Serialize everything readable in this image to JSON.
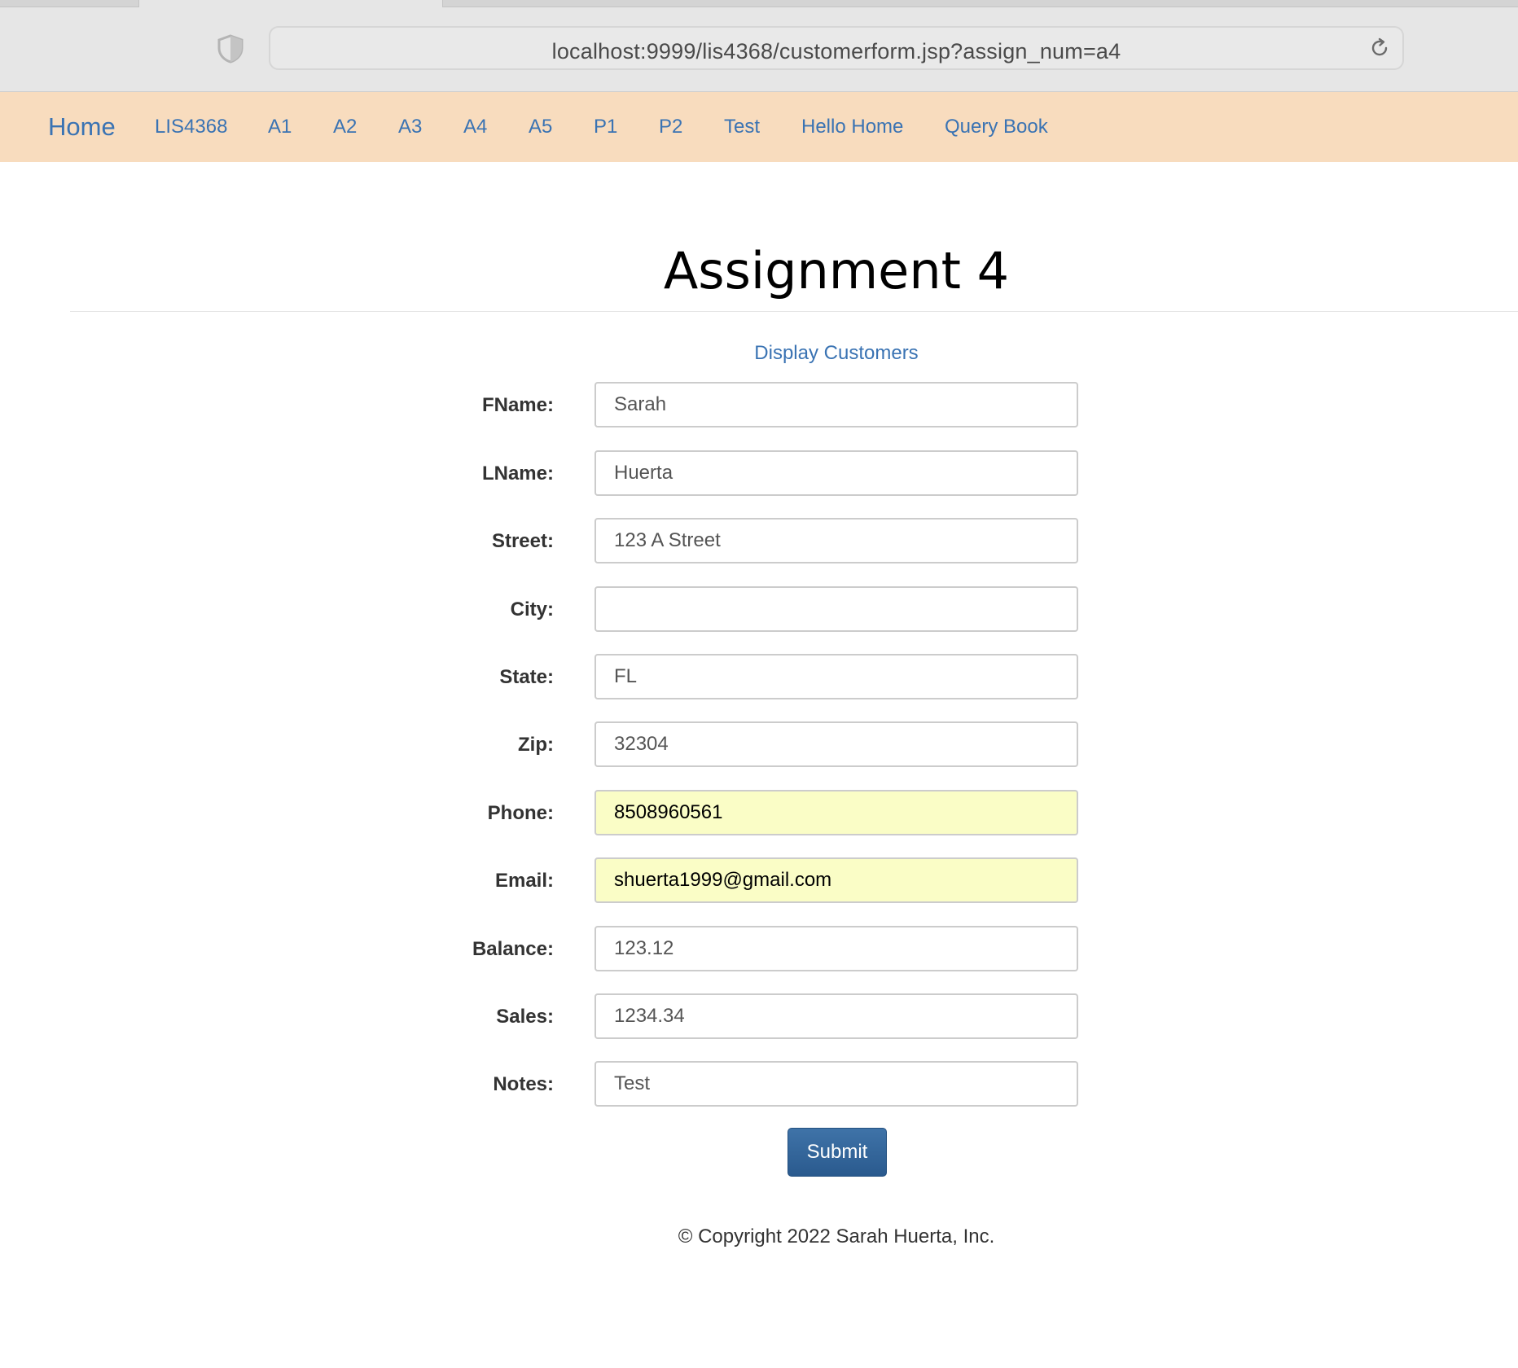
{
  "browser": {
    "url": "localhost:9999/lis4368/customerform.jsp?assign_num=a4"
  },
  "navbar": {
    "brand": "Home",
    "links": [
      "LIS4368",
      "A1",
      "A2",
      "A3",
      "A4",
      "A5",
      "P1",
      "P2",
      "Test",
      "Hello Home",
      "Query Book"
    ]
  },
  "page": {
    "title": "Assignment 4",
    "display_link": "Display Customers"
  },
  "form": {
    "fields": [
      {
        "label": "FName:",
        "value": "Sarah"
      },
      {
        "label": "LName:",
        "value": "Huerta"
      },
      {
        "label": "Street:",
        "value": "123 A Street"
      },
      {
        "label": "City:",
        "value": ""
      },
      {
        "label": "State:",
        "value": "FL"
      },
      {
        "label": "Zip:",
        "value": "32304"
      },
      {
        "label": "Phone:",
        "value": "8508960561"
      },
      {
        "label": "Email:",
        "value": "shuerta1999@gmail.com"
      },
      {
        "label": "Balance:",
        "value": "123.12"
      },
      {
        "label": "Sales:",
        "value": "1234.34"
      },
      {
        "label": "Notes:",
        "value": "Test"
      }
    ],
    "submit_label": "Submit"
  },
  "footer": {
    "copyright": "© Copyright 2022 Sarah Huerta, Inc."
  },
  "colors": {
    "navbar_bg": "#f8dcbe",
    "link": "#3a73b3",
    "autofill_bg": "#fafdc6",
    "submit_bg": "#356799"
  },
  "icons": {
    "privacy": "shield-icon",
    "reload": "reload-icon"
  }
}
